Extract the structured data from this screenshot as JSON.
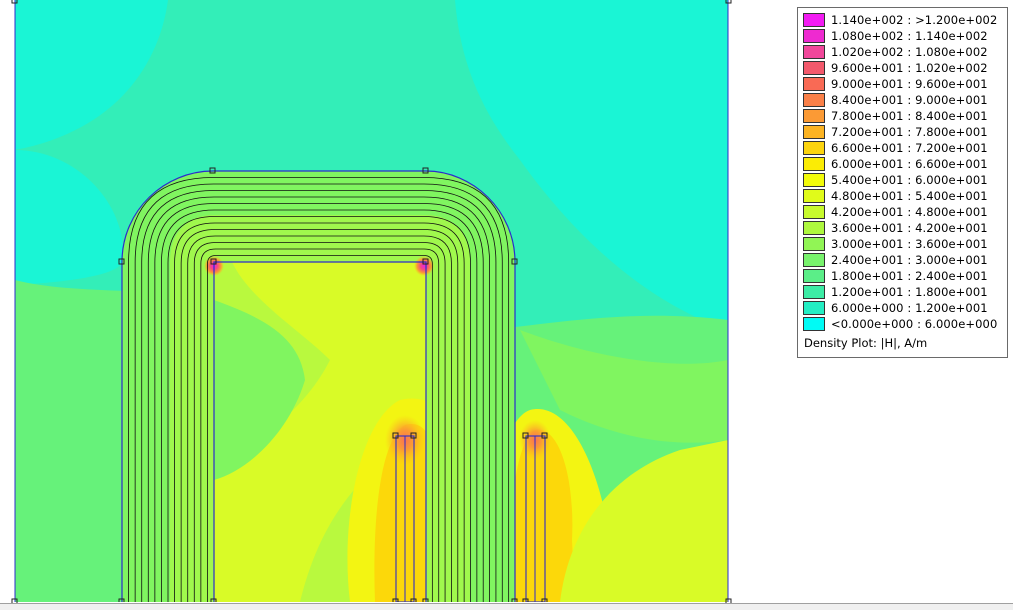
{
  "plot": {
    "background_color": "#ffffff",
    "field_colors": {
      "cyan": "#00ffff",
      "aqua": "#1af5d5",
      "mint": "#33eeb8",
      "lightgreen": "#66f27a",
      "green": "#80f560",
      "yellowgreen": "#b9f93e",
      "lime": "#d9fb27",
      "yellow": "#f3f512",
      "gold": "#fcd80a",
      "amber": "#fdbf1d",
      "orange": "#fb9a34",
      "salmon": "#fa7352",
      "pink": "#f44883",
      "magenta": "#ee22dd"
    },
    "geometry_line_color": "#2c2ccc",
    "flux_line_color": "#101010",
    "node_marker": "square"
  },
  "legend": {
    "entries": [
      {
        "label": "1.140e+002 : >1.200e+002",
        "color": "#f21bf2"
      },
      {
        "label": "1.080e+002 : 1.140e+002",
        "color": "#ee2ad0"
      },
      {
        "label": "1.020e+002 : 1.080e+002",
        "color": "#f1479b"
      },
      {
        "label": "9.600e+001 : 1.020e+002",
        "color": "#f3596c"
      },
      {
        "label": "9.000e+001 : 9.600e+001",
        "color": "#f96a55"
      },
      {
        "label": "8.400e+001 : 9.000e+001",
        "color": "#fa8048"
      },
      {
        "label": "7.800e+001 : 8.400e+001",
        "color": "#fb9a35"
      },
      {
        "label": "7.200e+001 : 7.800e+001",
        "color": "#fcb322"
      },
      {
        "label": "6.600e+001 : 7.200e+001",
        "color": "#fcd40e"
      },
      {
        "label": "6.000e+001 : 6.600e+001",
        "color": "#fbec05"
      },
      {
        "label": "5.400e+001 : 6.000e+001",
        "color": "#f3fb0a"
      },
      {
        "label": "4.800e+001 : 5.400e+001",
        "color": "#e0fb1a"
      },
      {
        "label": "4.200e+001 : 4.800e+001",
        "color": "#c8fa2c"
      },
      {
        "label": "3.600e+001 : 4.200e+001",
        "color": "#aef83e"
      },
      {
        "label": "3.000e+001 : 3.600e+001",
        "color": "#91f555"
      },
      {
        "label": "2.400e+001 : 3.000e+001",
        "color": "#78f26c"
      },
      {
        "label": "1.800e+001 : 2.400e+001",
        "color": "#5bee88"
      },
      {
        "label": "1.200e+001 : 1.800e+001",
        "color": "#3ceca5"
      },
      {
        "label": "6.000e+000 : 1.200e+001",
        "color": "#23eec3"
      },
      {
        "label": "<0.000e+000 : 6.000e+000",
        "color": "#00fbf5"
      }
    ],
    "caption": "Density Plot: |H|, A/m"
  }
}
